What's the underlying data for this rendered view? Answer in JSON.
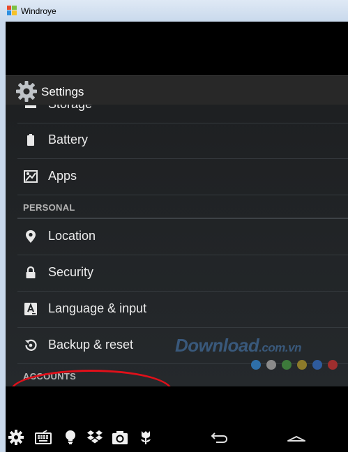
{
  "window": {
    "title": "Windroye"
  },
  "app": {
    "title": "Settings"
  },
  "settings": {
    "items": [
      {
        "label": "Storage",
        "icon": "storage-icon"
      },
      {
        "label": "Battery",
        "icon": "battery-icon"
      },
      {
        "label": "Apps",
        "icon": "apps-icon"
      },
      {
        "label": "Location",
        "icon": "location-icon"
      },
      {
        "label": "Security",
        "icon": "lock-icon"
      },
      {
        "label": "Language & input",
        "icon": "keyboard-a-icon"
      },
      {
        "label": "Backup & reset",
        "icon": "backup-icon"
      }
    ],
    "sections": [
      {
        "label": "PERSONAL"
      },
      {
        "label": "ACCOUNTS"
      }
    ]
  },
  "watermark": {
    "text": "Download",
    "suffix": ".com.vn"
  },
  "watermark_dot_colors": [
    "#2e6fa8",
    "#8a8a8a",
    "#3d7a3b",
    "#8c7a2a",
    "#2e5b9e",
    "#9e2e2e"
  ],
  "taskbar": {
    "icons": [
      "settings-icon",
      "keyboard-icon",
      "lightbulb-icon",
      "dropbox-icon",
      "camera-icon",
      "tulip-icon"
    ],
    "nav": [
      "back-icon",
      "home-icon"
    ]
  },
  "colors": {
    "highlight": "#e0101a",
    "background": "#1e2022",
    "text": "#ececec"
  }
}
